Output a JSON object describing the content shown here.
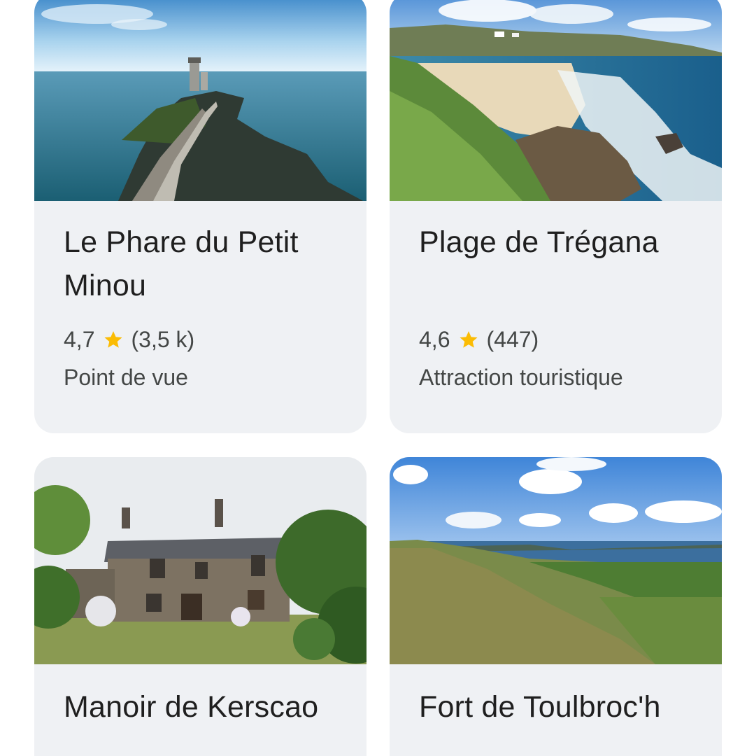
{
  "places": [
    {
      "title": "Le Phare du Petit Minou",
      "rating": "4,7",
      "reviews": "(3,5 k)",
      "category": "Point de vue",
      "photo_icon": "lighthouse-photo"
    },
    {
      "title": "Plage de Trégana",
      "rating": "4,6",
      "reviews": "(447)",
      "category": "Attraction touristique",
      "photo_icon": "beach-photo"
    },
    {
      "title": "Manoir de Kerscao",
      "photo_icon": "manor-photo"
    },
    {
      "title": "Fort de Toulbroc'h",
      "photo_icon": "coastal-landscape-photo"
    }
  ],
  "colors": {
    "card_bg": "#eff1f4",
    "title_text": "#1f1f1f",
    "secondary_text": "#444746",
    "star": "#fbbc04"
  }
}
